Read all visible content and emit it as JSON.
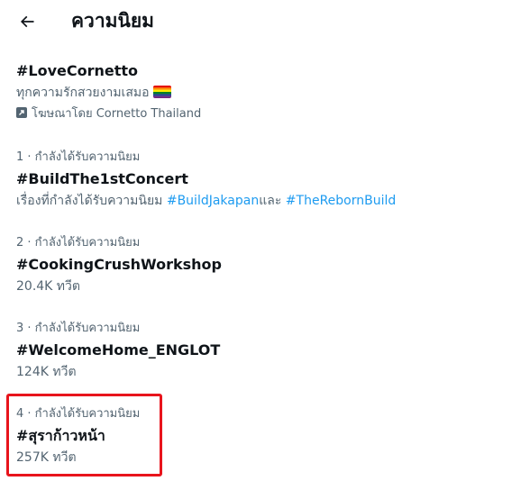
{
  "header": {
    "title": "ความนิยม"
  },
  "promoted": {
    "tag": "#LoveCornetto",
    "description": "ทุกความรักสวยงามเสมอ",
    "promoted_by": "โฆษณาโดย Cornetto Thailand",
    "emoji": "rainbow-flag-icon"
  },
  "trends": [
    {
      "meta": "1 · กำลังได้รับความนิยม",
      "tag": "#BuildThe1stConcert",
      "sub_prefix": "เรื่องที่กำลังได้รับความนิยม ",
      "sub_link1": "#BuildJakapan",
      "sub_join": "และ ",
      "sub_link2": "#TheRebornBuild"
    },
    {
      "meta": "2 · กำลังได้รับความนิยม",
      "tag": "#CookingCrushWorkshop",
      "count": "20.4K ทวีต"
    },
    {
      "meta": "3 · กำลังได้รับความนิยม",
      "tag": "#WelcomeHome_ENGLOT",
      "count": "124K ทวีต"
    },
    {
      "meta": "4 · กำลังได้รับความนิยม",
      "tag": "#สุราก้าวหน้า",
      "count": "257K ทวีต"
    }
  ],
  "colors": {
    "text_primary": "#0f1419",
    "text_secondary": "#536471",
    "link": "#1d9bf0",
    "highlight_border": "#e8141c"
  }
}
